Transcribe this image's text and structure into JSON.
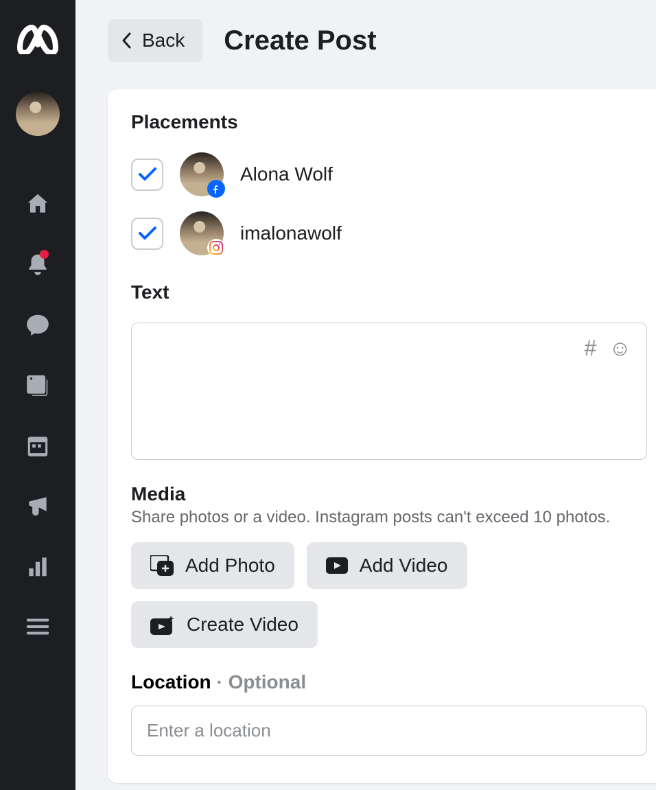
{
  "topbar": {
    "back_label": "Back",
    "page_title": "Create Post"
  },
  "sections": {
    "placements_heading": "Placements",
    "text_heading": "Text",
    "media_heading": "Media",
    "media_subtitle": "Share photos or a video. Instagram posts can't exceed 10 photos.",
    "location_heading": "Location",
    "location_optional": "Optional",
    "separator": " · "
  },
  "placements": [
    {
      "name": "Alona Wolf",
      "platform": "facebook",
      "checked": true
    },
    {
      "name": "imalonawolf",
      "platform": "instagram",
      "checked": true
    }
  ],
  "media_buttons": {
    "add_photo": "Add Photo",
    "add_video": "Add Video",
    "create_video": "Create Video"
  },
  "location": {
    "placeholder": "Enter a location",
    "value": ""
  },
  "sidebar": {
    "items": [
      "home",
      "notifications",
      "messages",
      "posts",
      "planner",
      "ads",
      "insights",
      "menu"
    ]
  }
}
